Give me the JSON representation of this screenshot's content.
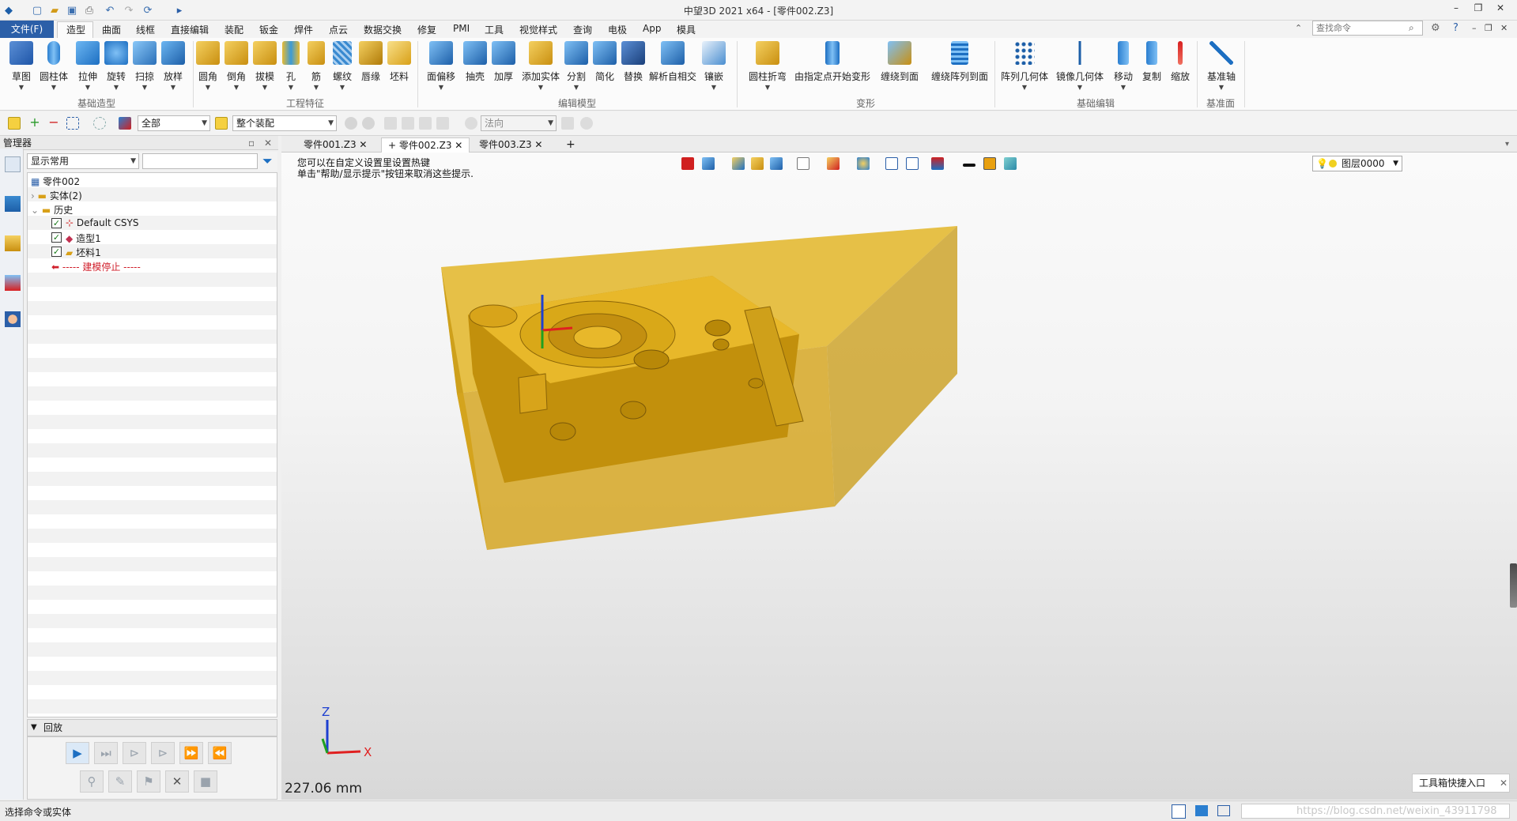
{
  "window": {
    "title": "中望3D 2021 x64 - [零件002.Z3]",
    "controls": [
      "–",
      "❐",
      "✕"
    ]
  },
  "menubar": {
    "file": "文件(F)",
    "tabs": [
      "造型",
      "曲面",
      "线框",
      "直接编辑",
      "装配",
      "钣金",
      "焊件",
      "点云",
      "数据交换",
      "修复",
      "PMI",
      "工具",
      "视觉样式",
      "查询",
      "电极",
      "App",
      "模具"
    ],
    "search_placeholder": "查找命令"
  },
  "ribbon": {
    "groups": [
      {
        "name": "基础造型",
        "items": [
          "草图",
          "圆柱体",
          "拉伸",
          "旋转",
          "扫掠",
          "放样"
        ]
      },
      {
        "name": "工程特征",
        "items": [
          "圆角",
          "倒角",
          "拔模",
          "孔",
          "筋",
          "螺纹",
          "唇缘",
          "坯料"
        ]
      },
      {
        "name": "编辑模型",
        "items": [
          "面偏移",
          "抽壳",
          "加厚",
          "添加实体",
          "分割",
          "简化",
          "替换",
          "解析自相交",
          "镶嵌"
        ]
      },
      {
        "name": "变形",
        "items": [
          "圆柱折弯",
          "由指定点开始变形",
          "缠绕到面",
          "缠绕阵列到面"
        ]
      },
      {
        "name": "基础编辑",
        "items": [
          "阵列几何体",
          "镜像几何体",
          "移动",
          "复制",
          "缩放"
        ]
      },
      {
        "name": "基准面",
        "items": [
          "基准轴"
        ]
      }
    ]
  },
  "filterbar": {
    "filter_value": "全部",
    "scope_value": "整个装配",
    "direction_value": "法向"
  },
  "manager": {
    "title": "管理器",
    "display_select": "显示常用",
    "tree": {
      "root": "零件002",
      "solids": "实体(2)",
      "history": "历史",
      "items": [
        "Default CSYS",
        "造型1",
        "坯料1"
      ],
      "stop": "----- 建模停止 -----"
    },
    "playback": "回放"
  },
  "doctabs": [
    "零件001.Z3",
    "零件002.Z3",
    "零件003.Z3"
  ],
  "viewport": {
    "hint_line1": "您可以在自定义设置里设置热键",
    "hint_line2": "单击\"帮助/显示提示\"按钮来取消这些提示.",
    "layer": "图层0000",
    "scale": "227.06 mm",
    "shortcut": "工具箱快捷入口",
    "axis_x": "X",
    "axis_z": "Z"
  },
  "status": {
    "text": "选择命令或实体",
    "watermark": "https://blog.csdn.net/weixin_43911798"
  },
  "colors": {
    "accent": "#2b5fa8",
    "part": "#d9a514",
    "part_dark": "#b88a0c",
    "stock": "#e0b020"
  }
}
